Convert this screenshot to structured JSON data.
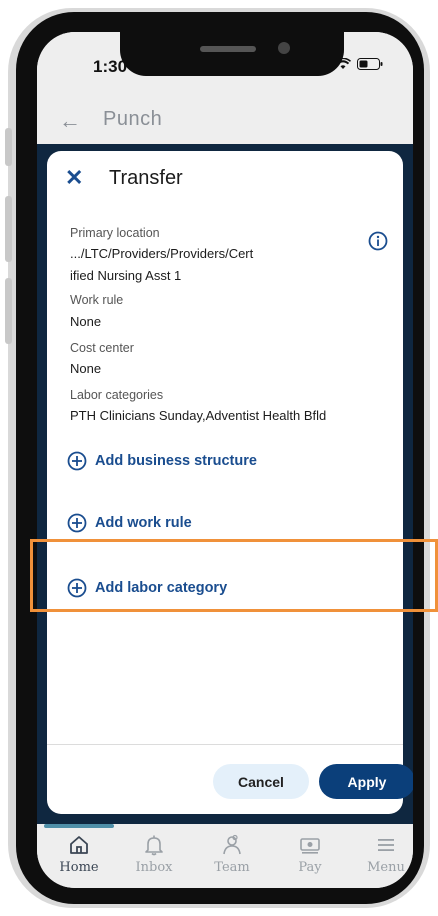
{
  "status_bar": {
    "time": "1:30",
    "icons": [
      "signal-icon",
      "wifi-icon",
      "battery-icon"
    ]
  },
  "header": {
    "back_icon": "back-arrow-icon",
    "title": "Punch"
  },
  "modal": {
    "close_icon": "close-icon",
    "title": "Transfer",
    "fields": [
      {
        "label": "Primary location",
        "value_line1": ".../LTC/Providers/Providers/Cert",
        "value_line2": "ified Nursing Asst 1"
      },
      {
        "label": "Work rule",
        "value": "None"
      },
      {
        "label": "Cost center",
        "value": "None"
      },
      {
        "label": "Labor categories",
        "value": "PTH Clinicians Sunday,Adventist Health Bfld"
      }
    ],
    "info_icon": "info-icon",
    "actions": [
      {
        "label": "Add business structure",
        "icon": "plus-circle-icon"
      },
      {
        "label": "Add work rule",
        "icon": "plus-circle-icon"
      },
      {
        "label": "Add labor category",
        "icon": "plus-circle-icon"
      }
    ],
    "cancel_label": "Cancel",
    "apply_label": "Apply"
  },
  "tabbar": {
    "tabs": [
      {
        "label": "Home",
        "icon": "home-icon",
        "active": true
      },
      {
        "label": "Inbox",
        "icon": "bell-icon",
        "active": false
      },
      {
        "label": "Team",
        "icon": "team-icon",
        "active": false
      },
      {
        "label": "Pay",
        "icon": "pay-icon",
        "active": false
      },
      {
        "label": "Menu",
        "icon": "menu-icon",
        "active": false
      }
    ]
  },
  "colors": {
    "accent": "#1a4d8f",
    "apply_bg": "#0b3f7a",
    "cancel_bg": "#e4f0fa",
    "backdrop": "#0f2740",
    "highlight": "#f0913a",
    "tab_inactive": "#9aa0a6",
    "tab_active": "#3b4654"
  }
}
